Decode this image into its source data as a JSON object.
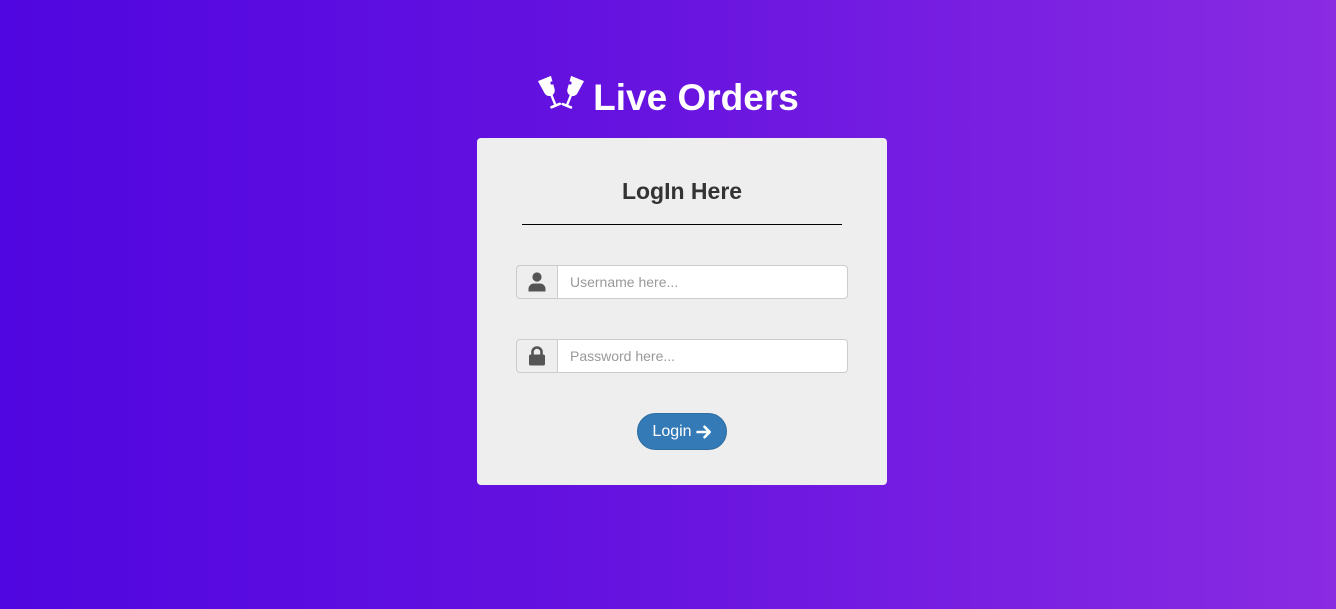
{
  "brand": {
    "title": "Live Orders",
    "icon": "glass-cheers-icon"
  },
  "login_form": {
    "heading": "LogIn Here",
    "username": {
      "icon": "user-icon",
      "value": "",
      "placeholder": "Username here..."
    },
    "password": {
      "icon": "lock-icon",
      "value": "",
      "placeholder": "Password here..."
    },
    "submit": {
      "label": "Login",
      "icon": "arrow-right-icon"
    }
  },
  "colors": {
    "background_gradient_start": "#5006e0",
    "background_gradient_end": "#8a2be2",
    "card_background": "#eeeeee",
    "button_primary": "#337ab7",
    "text_dark": "#333333"
  }
}
